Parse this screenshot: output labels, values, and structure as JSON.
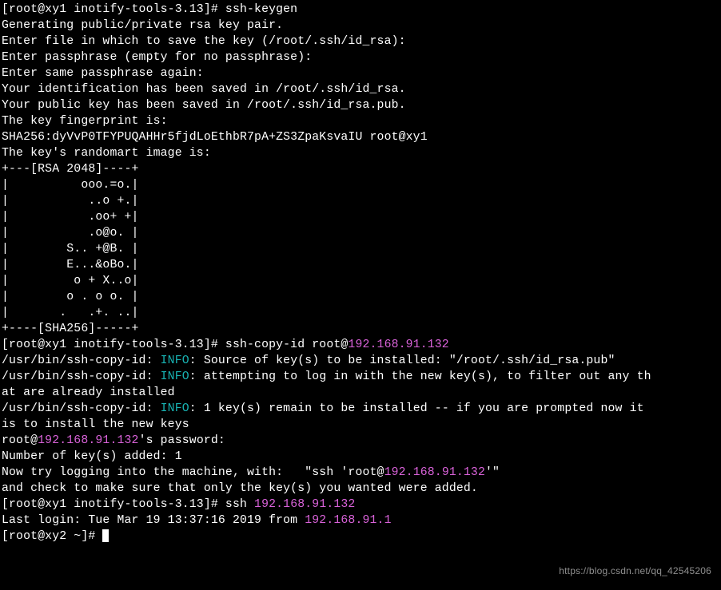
{
  "terminal": {
    "lines": [
      {
        "segments": [
          {
            "text": "[root@xy1 inotify-tools-3.13]# ssh-keygen",
            "cls": ""
          }
        ]
      },
      {
        "segments": [
          {
            "text": "Generating public/private rsa key pair.",
            "cls": ""
          }
        ]
      },
      {
        "segments": [
          {
            "text": "Enter file in which to save the key (/root/.ssh/id_rsa):",
            "cls": ""
          }
        ]
      },
      {
        "segments": [
          {
            "text": "Enter passphrase (empty for no passphrase):",
            "cls": ""
          }
        ]
      },
      {
        "segments": [
          {
            "text": "Enter same passphrase again:",
            "cls": ""
          }
        ]
      },
      {
        "segments": [
          {
            "text": "Your identification has been saved in /root/.ssh/id_rsa.",
            "cls": ""
          }
        ]
      },
      {
        "segments": [
          {
            "text": "Your public key has been saved in /root/.ssh/id_rsa.pub.",
            "cls": ""
          }
        ]
      },
      {
        "segments": [
          {
            "text": "The key fingerprint is:",
            "cls": ""
          }
        ]
      },
      {
        "segments": [
          {
            "text": "SHA256:dyVvP0TFYPUQAHHr5fjdLoEthbR7pA+ZS3ZpaKsvaIU root@xy1",
            "cls": ""
          }
        ]
      },
      {
        "segments": [
          {
            "text": "The key's randomart image is:",
            "cls": ""
          }
        ]
      },
      {
        "segments": [
          {
            "text": "+---[RSA 2048]----+",
            "cls": ""
          }
        ]
      },
      {
        "segments": [
          {
            "text": "|          ooo.=o.|",
            "cls": ""
          }
        ]
      },
      {
        "segments": [
          {
            "text": "|           ..o +.|",
            "cls": ""
          }
        ]
      },
      {
        "segments": [
          {
            "text": "|           .oo+ +|",
            "cls": ""
          }
        ]
      },
      {
        "segments": [
          {
            "text": "|           .o@o. |",
            "cls": ""
          }
        ]
      },
      {
        "segments": [
          {
            "text": "|        S.. +@B. |",
            "cls": ""
          }
        ]
      },
      {
        "segments": [
          {
            "text": "|        E...&oBo.|",
            "cls": ""
          }
        ]
      },
      {
        "segments": [
          {
            "text": "|         o + X..o|",
            "cls": ""
          }
        ]
      },
      {
        "segments": [
          {
            "text": "|        o . o o. |",
            "cls": ""
          }
        ]
      },
      {
        "segments": [
          {
            "text": "|       .   .+. ..|",
            "cls": ""
          }
        ]
      },
      {
        "segments": [
          {
            "text": "+----[SHA256]-----+",
            "cls": ""
          }
        ]
      },
      {
        "segments": [
          {
            "text": "[root@xy1 inotify-tools-3.13]# ssh-copy-id root@",
            "cls": ""
          },
          {
            "text": "192.168.91.132",
            "cls": "magenta"
          }
        ]
      },
      {
        "segments": [
          {
            "text": "/usr/bin/ssh-copy-id: ",
            "cls": ""
          },
          {
            "text": "INFO",
            "cls": "cyan"
          },
          {
            "text": ": Source of key(s) to be installed: \"/root/.ssh/id_rsa.pub\"",
            "cls": ""
          }
        ]
      },
      {
        "segments": [
          {
            "text": "/usr/bin/ssh-copy-id: ",
            "cls": ""
          },
          {
            "text": "INFO",
            "cls": "cyan"
          },
          {
            "text": ": attempting to log in with the new key(s), to filter out any th",
            "cls": ""
          }
        ]
      },
      {
        "segments": [
          {
            "text": "at are already installed",
            "cls": ""
          }
        ]
      },
      {
        "segments": [
          {
            "text": "/usr/bin/ssh-copy-id: ",
            "cls": ""
          },
          {
            "text": "INFO",
            "cls": "cyan"
          },
          {
            "text": ": 1 key(s) remain to be installed -- if you are prompted now it ",
            "cls": ""
          }
        ]
      },
      {
        "segments": [
          {
            "text": "is to install the new keys",
            "cls": ""
          }
        ]
      },
      {
        "segments": [
          {
            "text": "root@",
            "cls": ""
          },
          {
            "text": "192.168.91.132",
            "cls": "magenta"
          },
          {
            "text": "'s password:",
            "cls": ""
          }
        ]
      },
      {
        "segments": [
          {
            "text": "",
            "cls": ""
          }
        ]
      },
      {
        "segments": [
          {
            "text": "Number of key(s) added: 1",
            "cls": ""
          }
        ]
      },
      {
        "segments": [
          {
            "text": "",
            "cls": ""
          }
        ]
      },
      {
        "segments": [
          {
            "text": "Now try logging into the machine, with:   \"ssh 'root@",
            "cls": ""
          },
          {
            "text": "192.168.91.132",
            "cls": "magenta"
          },
          {
            "text": "'\"",
            "cls": ""
          }
        ]
      },
      {
        "segments": [
          {
            "text": "and check to make sure that only the key(s) you wanted were added.",
            "cls": ""
          }
        ]
      },
      {
        "segments": [
          {
            "text": "",
            "cls": ""
          }
        ]
      },
      {
        "segments": [
          {
            "text": "[root@xy1 inotify-tools-3.13]# ssh ",
            "cls": ""
          },
          {
            "text": "192.168.91.132",
            "cls": "magenta"
          }
        ]
      },
      {
        "segments": [
          {
            "text": "Last login: Tue Mar 19 13:37:16 2019 from ",
            "cls": ""
          },
          {
            "text": "192.168.91.1",
            "cls": "magenta"
          }
        ]
      },
      {
        "segments": [
          {
            "text": "[root@xy2 ~]# ",
            "cls": ""
          }
        ],
        "cursor": true
      }
    ]
  },
  "watermark": "https://blog.csdn.net/qq_42545206"
}
